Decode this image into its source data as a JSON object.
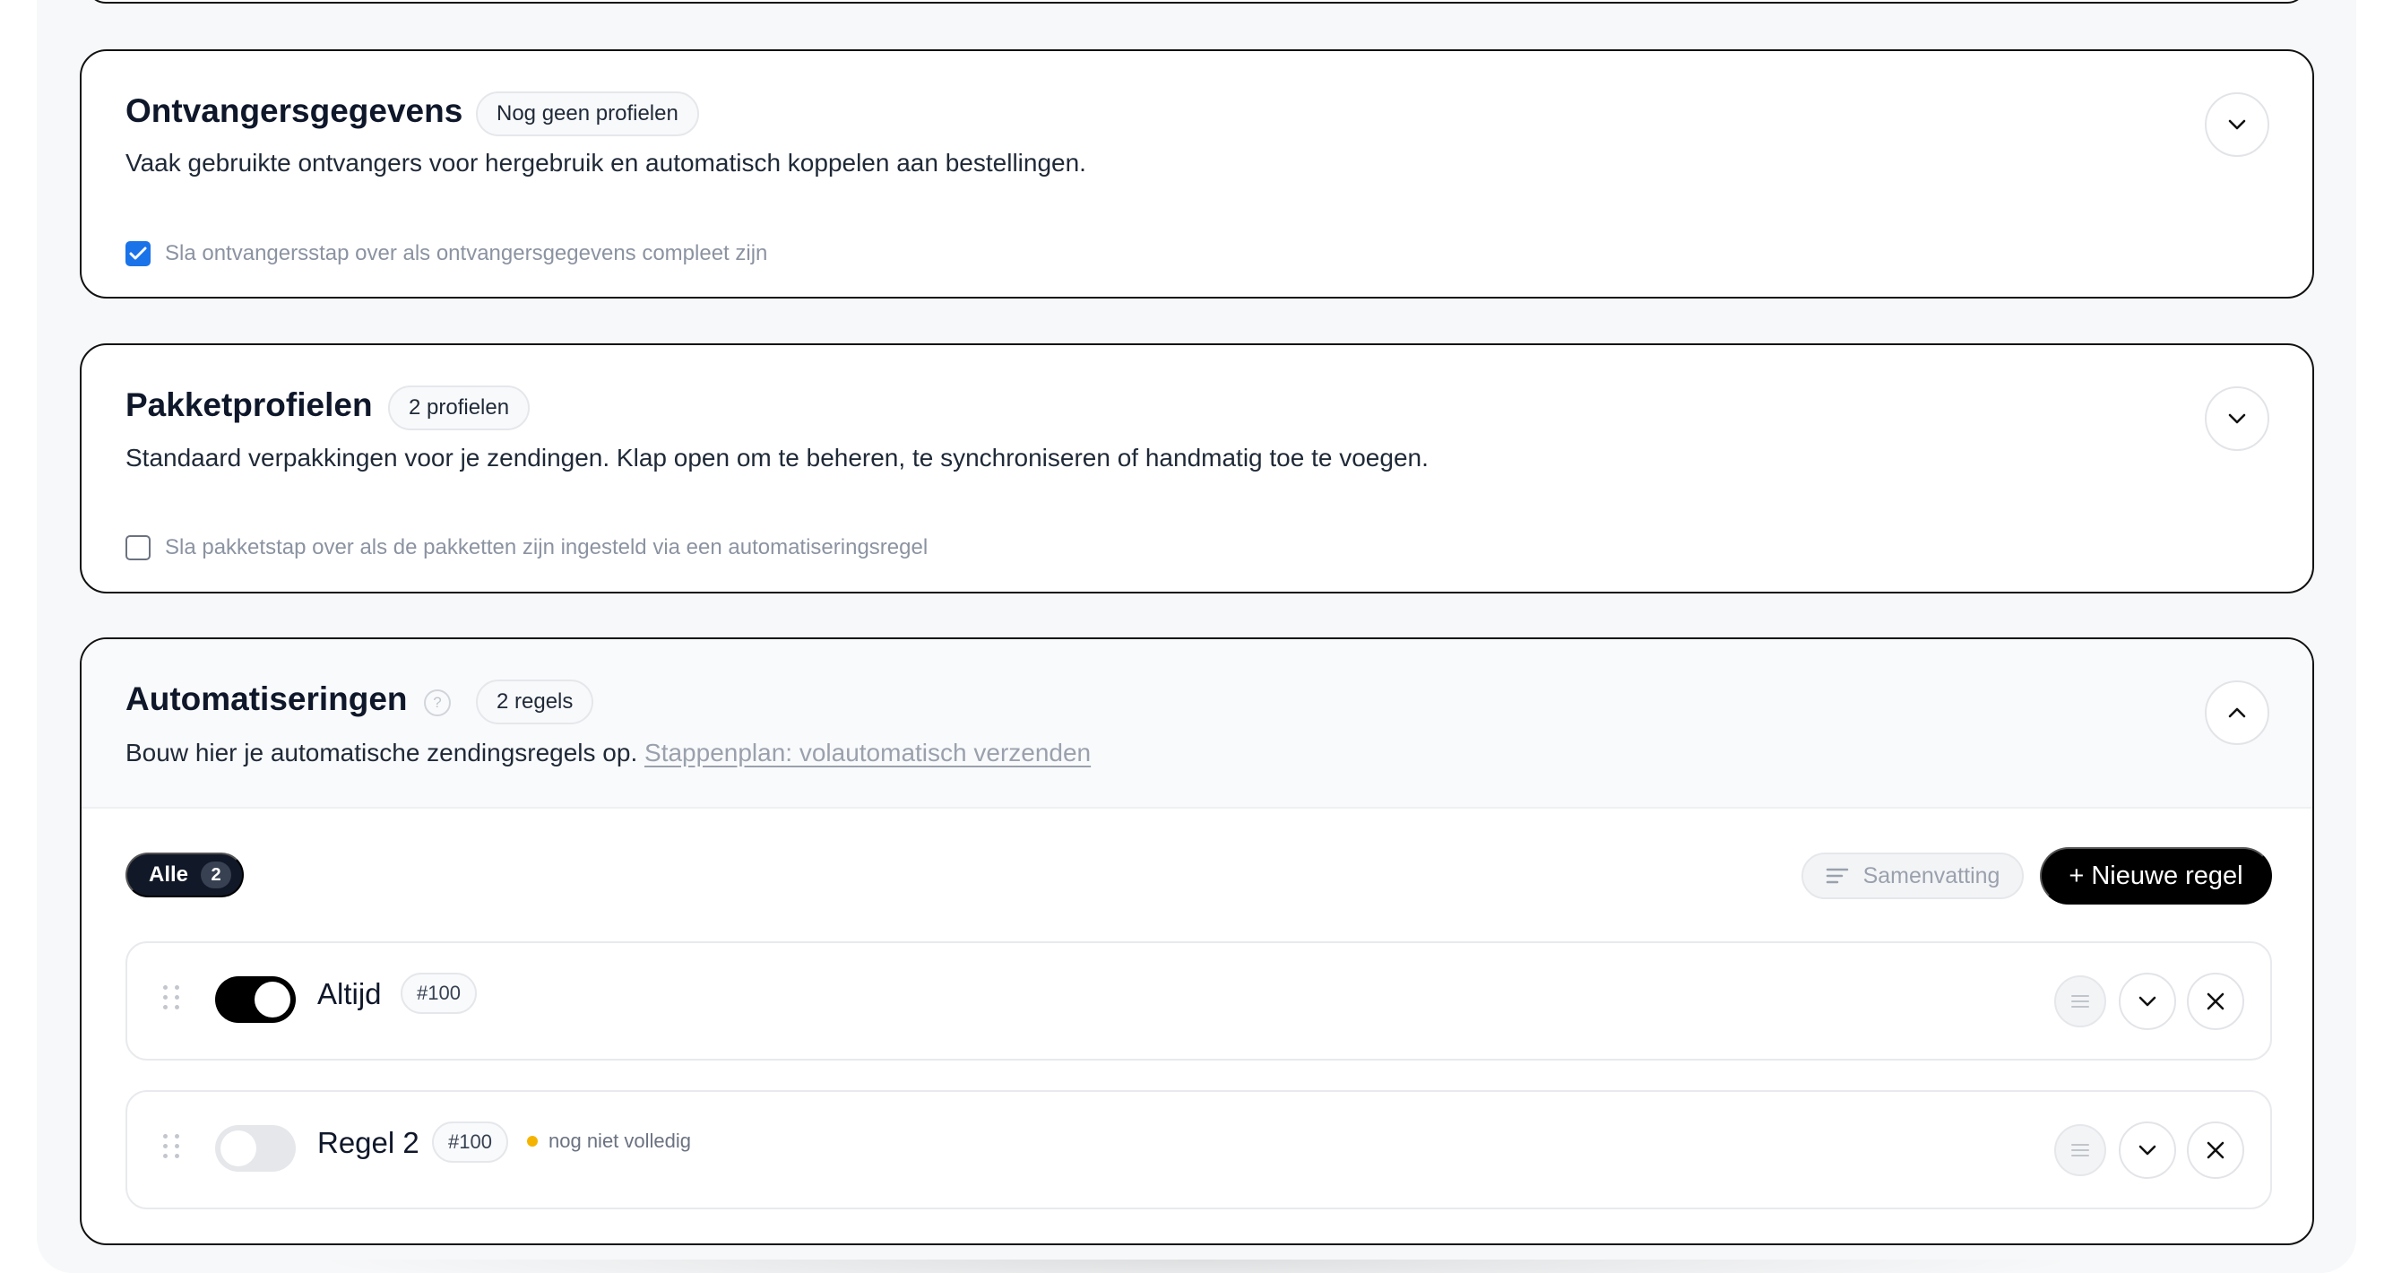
{
  "sections": {
    "recipients": {
      "title": "Ontvangersgegevens",
      "badge": "Nog geen profielen",
      "description": "Vaak gebruikte ontvangers voor hergebruik en automatisch koppelen aan bestellingen.",
      "checkbox_label": "Sla ontvangersstap over als ontvangersgegevens compleet zijn",
      "checkbox_checked": true
    },
    "packages": {
      "title": "Pakketprofielen",
      "badge": "2 profielen",
      "description": "Standaard verpakkingen voor je zendingen. Klap open om te beheren, te synchroniseren of handmatig toe te voegen.",
      "checkbox_label": "Sla pakketstap over als de pakketten zijn ingesteld via een automatiseringsregel",
      "checkbox_checked": false
    },
    "automations": {
      "title": "Automatiseringen",
      "help_icon": "?",
      "badge": "2 regels",
      "description": "Bouw hier je automatische zendingsregels op.",
      "link_text": "Stappenplan: volautomatisch verzenden",
      "filter_label": "Alle",
      "filter_count": "2",
      "summary_label": "Samenvatting",
      "new_rule_label": "+ Nieuwe regel",
      "rules": [
        {
          "name": "Altijd",
          "priority": "#100",
          "enabled": true,
          "status": ""
        },
        {
          "name": "Regel 2",
          "priority": "#100",
          "enabled": false,
          "status": "nog niet volledig"
        }
      ]
    }
  },
  "colors": {
    "accent_checkbox": "#1a73e8",
    "status_warning": "#f5b301",
    "primary_button": "#000000"
  }
}
